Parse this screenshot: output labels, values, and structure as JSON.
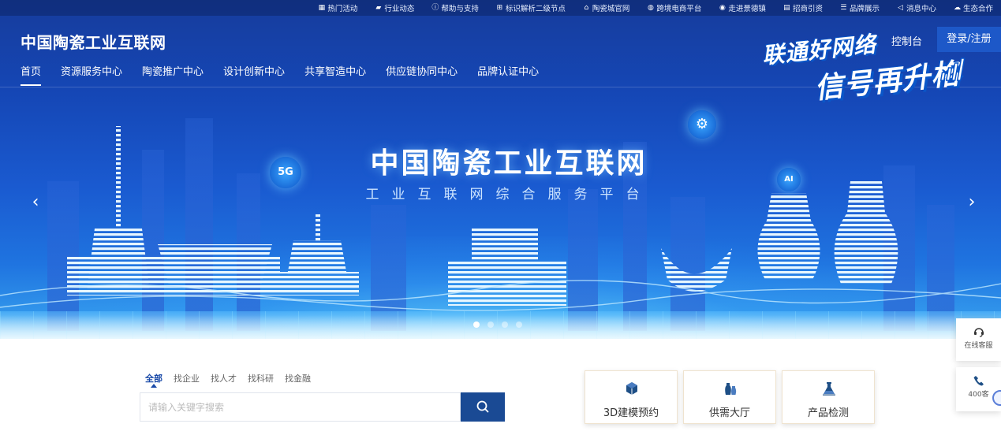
{
  "topbar": {
    "items": [
      {
        "icon": "fire-grid-icon",
        "label": "热门活动"
      },
      {
        "icon": "folder-icon",
        "label": "行业动态"
      },
      {
        "icon": "info-icon",
        "label": "帮助与支持"
      },
      {
        "icon": "network-icon",
        "label": "标识解析二级节点"
      },
      {
        "icon": "building-icon",
        "label": "陶瓷城官网"
      },
      {
        "icon": "globe-icon",
        "label": "跨境电商平台"
      },
      {
        "icon": "location-icon",
        "label": "走进景德镇"
      },
      {
        "icon": "document-icon",
        "label": "招商引资"
      },
      {
        "icon": "list-icon",
        "label": "品牌展示"
      },
      {
        "icon": "speaker-icon",
        "label": "消息中心"
      },
      {
        "icon": "cloud-icon",
        "label": "生态合作"
      }
    ]
  },
  "header": {
    "logo": "中国陶瓷工业互联网",
    "console": "控制台",
    "login": "登录/注册",
    "nav": [
      "首页",
      "资源服务中心",
      "陶瓷推广中心",
      "设计创新中心",
      "共享智造中心",
      "供应链协同中心",
      "品牌认证中心"
    ]
  },
  "promo": {
    "line1": "联通好网络",
    "line2": "信号再升格"
  },
  "banner": {
    "title": "中国陶瓷工业互联网",
    "subtitle": "工业互联网综合服务平台",
    "badges": {
      "g5": "5G",
      "ai": "AI"
    },
    "prev_arrow": "‹",
    "next_arrow": "›",
    "dots": 4,
    "active_dot": 1
  },
  "search": {
    "tabs": [
      "全部",
      "找企业",
      "找人才",
      "找科研",
      "找金融"
    ],
    "active_tab": 0,
    "placeholder": "请输入关键字搜索",
    "button_icon": "search-icon"
  },
  "quick": [
    {
      "icon": "cube-icon",
      "label": "3D建模预约"
    },
    {
      "icon": "vase-icon",
      "label": "供需大厅"
    },
    {
      "icon": "flask-icon",
      "label": "产品检测"
    }
  ],
  "side": {
    "service": {
      "icon": "headset-icon",
      "label": "在线客服"
    },
    "phone": {
      "icon": "phone-icon",
      "label": "400客"
    }
  },
  "colors": {
    "primary": "#1a4a94",
    "banner_top": "#163c9c",
    "banner_bottom": "#3aa6f0",
    "accent_gold": "#c8a058"
  }
}
